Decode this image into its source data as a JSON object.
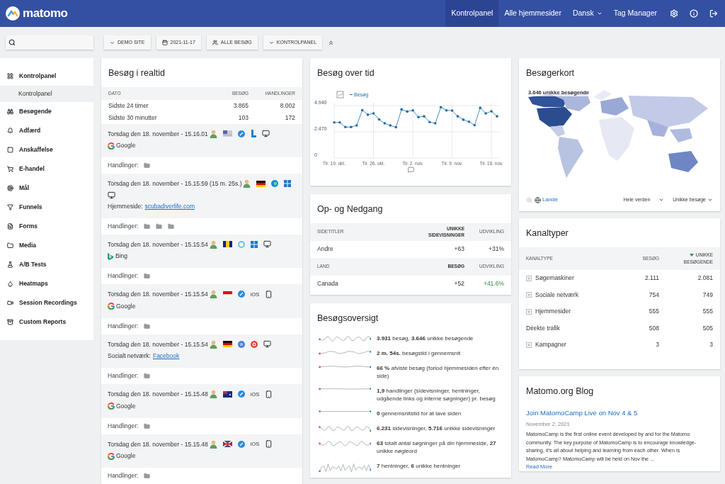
{
  "header": {
    "logo": "matomo",
    "nav": [
      {
        "label": "Kontrolpanel",
        "selected": true,
        "has_menu": false
      },
      {
        "label": "Alle hjemmesider",
        "selected": false,
        "has_menu": false
      },
      {
        "label": "Dansk",
        "selected": false,
        "has_menu": true
      },
      {
        "label": "Tag Manager",
        "selected": false,
        "has_menu": false
      }
    ]
  },
  "toolbar": {
    "buttons": [
      {
        "kind": "caret",
        "label": "DEMO SITE"
      },
      {
        "kind": "calendar",
        "label": "2021-11-17"
      },
      {
        "kind": "segment",
        "label": "ALLE BESØG"
      },
      {
        "kind": "caret",
        "label": "KONTROLPANEL"
      }
    ]
  },
  "sidebar": {
    "items": [
      {
        "label": "Kontrolpanel",
        "selected": false,
        "children": [
          {
            "label": "Kontrolpanel",
            "selected": true
          }
        ]
      },
      {
        "label": "Besøgende",
        "selected": false
      },
      {
        "label": "Adfærd",
        "selected": false
      },
      {
        "label": "Anskaffelse",
        "selected": false
      },
      {
        "label": "E-handel",
        "selected": false
      },
      {
        "label": "Mål",
        "selected": false
      },
      {
        "label": "Funnels",
        "selected": false
      },
      {
        "label": "Forms",
        "selected": false
      },
      {
        "label": "Media",
        "selected": false
      },
      {
        "label": "A/B Tests",
        "selected": false
      },
      {
        "label": "Heatmaps",
        "selected": false
      },
      {
        "label": "Session Recordings",
        "selected": false
      },
      {
        "label": "Custom Reports",
        "selected": false
      }
    ]
  },
  "realtime": {
    "title": "Besøg i realtid",
    "columns": [
      "DATO",
      "BESØG",
      "HANDLINGER"
    ],
    "rows": [
      {
        "label": "Sidste 24 timer",
        "visits": "3.865",
        "actions": "8.002"
      },
      {
        "label": "Sidste 30 minutter",
        "visits": "103",
        "actions": "172"
      }
    ],
    "visits": [
      {
        "time": "Torsdag den 18. november - 15.16.01",
        "icons": [
          {
            "kind": "visitor"
          },
          {
            "kind": "flag-us"
          },
          {
            "kind": "safari"
          },
          {
            "kind": "os-blue"
          },
          {
            "kind": "desktop"
          }
        ],
        "referrer": {
          "kind": "search",
          "name": "Google"
        },
        "actions_label": "Handlinger:",
        "actions": [
          {
            "kind": "folder"
          }
        ]
      },
      {
        "time": "Torsdag den 18. november - 15.15.59 (15 m. 25s.)",
        "icons": [
          {
            "kind": "visitor"
          },
          {
            "kind": "flag-de"
          },
          {
            "kind": "edge"
          },
          {
            "kind": "windows"
          },
          {
            "kind": "desktop"
          }
        ],
        "referrer": {
          "kind": "link",
          "label": "Hjemmeside:",
          "name": "scubadiverlife.com"
        },
        "actions_label": "Handlinger:",
        "actions": [
          {
            "kind": "folder"
          },
          {
            "kind": "folder"
          },
          {
            "kind": "folder"
          }
        ]
      },
      {
        "time": "Torsdag den 18. november - 15.15.54",
        "icons": [
          {
            "kind": "visitor"
          },
          {
            "kind": "flag-bb"
          },
          {
            "kind": "ie"
          },
          {
            "kind": "windows"
          },
          {
            "kind": "desktop"
          }
        ],
        "referrer": {
          "kind": "bing",
          "name": "Bing"
        },
        "actions_label": "Handlinger:",
        "actions": [
          {
            "kind": "folder"
          }
        ]
      },
      {
        "time": "Torsdag den 18. november - 15.15.54",
        "icons": [
          {
            "kind": "visitor"
          },
          {
            "kind": "flag-id"
          },
          {
            "kind": "safari"
          },
          {
            "kind": "os-text",
            "label": "iOS"
          },
          {
            "kind": "phone"
          }
        ],
        "referrer": {
          "kind": "search",
          "name": "Google"
        },
        "actions_label": "Handlinger:",
        "actions": [
          {
            "kind": "folder"
          }
        ]
      },
      {
        "time": "Torsdag den 18. november - 15.15.54",
        "icons": [
          {
            "kind": "visitor"
          },
          {
            "kind": "flag-de"
          },
          {
            "kind": "chrome"
          },
          {
            "kind": "target"
          },
          {
            "kind": "desktop"
          }
        ],
        "referrer": {
          "kind": "link",
          "label": "Socialt netværk:",
          "name": "Facebook"
        },
        "actions_label": "Handlinger:",
        "actions": [
          {
            "kind": "folder"
          }
        ]
      },
      {
        "time": "Torsdag den 18. november - 15.15.48",
        "icons": [
          {
            "kind": "visitor"
          },
          {
            "kind": "flag-au"
          },
          {
            "kind": "safari"
          },
          {
            "kind": "os-text",
            "label": "iOS"
          },
          {
            "kind": "phone"
          }
        ],
        "referrer": {
          "kind": "search",
          "name": "Google"
        },
        "actions_label": "Handlinger:",
        "actions": [
          {
            "kind": "folder"
          }
        ]
      },
      {
        "time": "Torsdag den 18. november - 15.15.48",
        "icons": [
          {
            "kind": "visitor"
          },
          {
            "kind": "flag-gb"
          },
          {
            "kind": "safari"
          },
          {
            "kind": "os-text",
            "label": "iOS"
          },
          {
            "kind": "phone"
          }
        ],
        "referrer": {
          "kind": "search",
          "name": "Google"
        },
        "actions_label": "Handlinger:",
        "actions": [
          {
            "kind": "folder"
          }
        ]
      }
    ]
  },
  "visits_over_time": {
    "title": "Besøg over tid",
    "chart_data": {
      "type": "line",
      "categories": [
        "Tir. 19. okt.",
        null,
        null,
        null,
        null,
        null,
        null,
        "Tir. 26. okt.",
        null,
        null,
        null,
        null,
        null,
        null,
        "Tir. 2. nov.",
        null,
        null,
        null,
        null,
        null,
        null,
        "Tir. 9. nov.",
        null,
        null,
        null,
        null,
        null,
        null,
        "Tir. 16. nov.",
        null
      ],
      "ylim": [
        0,
        4.94
      ],
      "grid": true,
      "yticks": [
        0,
        {
          "value": 2.47,
          "label": "2.470"
        },
        {
          "value": 4.94,
          "label": "4.940"
        }
      ],
      "series": [
        {
          "name": "Besøg",
          "color": "#1f6fa8",
          "values": [
            3.35,
            3.35,
            2.92,
            2.92,
            3.07,
            4.51,
            4.08,
            4.21,
            3.63,
            3.27,
            3.07,
            2.9,
            4.58,
            4.38,
            4.49,
            3.85,
            3.93,
            3.39,
            3.27,
            4.79,
            4.49,
            4.47,
            3.93,
            3.61,
            3.42,
            3.09,
            4.73,
            4.21,
            4.4,
            3.93
          ]
        }
      ]
    }
  },
  "movers": {
    "title": "Op- og Nedgang",
    "sections": [
      {
        "columns": [
          "SIDETITLER",
          "UNIKKE SIDEVISNINGER",
          "UDVIKLING"
        ],
        "rows": [
          {
            "label": "Andre",
            "value": "+63",
            "change": "+31%",
            "significant": false
          }
        ]
      },
      {
        "columns": [
          "LAND",
          "BESØG",
          "UDVIKLING"
        ],
        "rows": [
          {
            "label": "Canada",
            "value": "+52",
            "change": "+41.6%",
            "significant": true
          }
        ]
      }
    ]
  },
  "overview": {
    "title": "Besøgsoversigt",
    "lines": [
      "**3.931** besøg, **3.646** unikke besøgende",
      "**2 m. 54s.** besøgstid i gennemsnit",
      "**66 %** afviste besøg (forlod hjemmesiden efter én side)",
      "**1,9** handlinger (sidevisninger, hentninger, udgående links og interne søgninger) pr. besøg",
      "**0** gennemsnitstid for at lave siden",
      "**6.231** sidevisninger, **5.716** unikke sidevisninger",
      "**63** totalt antal søgninger på din hjemmeside, **27** unikke nøgleord",
      "**7** hentninger, **6** unikke hentninger"
    ]
  },
  "visitor_map": {
    "title": "Besøgerkort",
    "summary": "3.646 unikke besøgende",
    "level_link": "Lande",
    "region": "Hele verden",
    "metric": "Unikke besøge"
  },
  "channels": {
    "title": "Kanaltyper",
    "columns": [
      {
        "label": "KANALTYPE",
        "sorted": false
      },
      {
        "label": "BESØG",
        "sorted": false
      },
      {
        "label": "UNIKKE BESØGENDE",
        "sorted": true
      }
    ],
    "rows": [
      {
        "label": "Søgemaskiner",
        "visits": "2.111",
        "unique": "2.081",
        "expandable": true
      },
      {
        "label": "Sociale netværk",
        "visits": "754",
        "unique": "749",
        "expandable": true
      },
      {
        "label": "Hjemmesider",
        "visits": "555",
        "unique": "555",
        "expandable": true
      },
      {
        "label": "Direkte trafik",
        "visits": "508",
        "unique": "505",
        "expandable": false
      },
      {
        "label": "Kampagner",
        "visits": "3",
        "unique": "3",
        "expandable": true
      }
    ]
  },
  "blog": {
    "title": "Matomo.org Blog",
    "post_title": "Join MatomoCamp Live on Nov 4 & 5",
    "date": "November 2, 2021",
    "excerpt": "MatomoCamp is the first online event developed by and for the Matomo community. The key purpose of MatomoCamp is to encourage knowledge-sharing, it’s all about helping and learning from each other. When is MatomoCamp? MatomoCamp will be held on Nov the ...",
    "read_more": "Read More"
  }
}
